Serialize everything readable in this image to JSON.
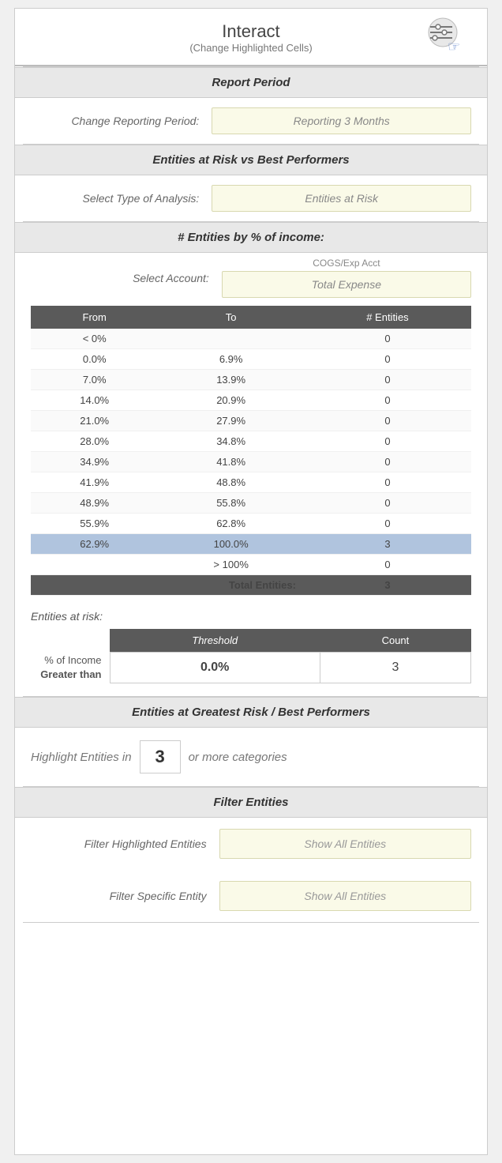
{
  "header": {
    "title": "Interact",
    "subtitle": "(Change Highlighted Cells)"
  },
  "report_period": {
    "label": "Report Period"
  },
  "change_reporting": {
    "label": "Change Reporting Period:",
    "dropdown": "Reporting 3 Months"
  },
  "entities_section": {
    "label": "Entities at Risk vs Best Performers"
  },
  "analysis": {
    "label": "Select Type of Analysis:",
    "dropdown": "Entities at Risk"
  },
  "entities_by_income": {
    "label": "# Entities by % of income:"
  },
  "account": {
    "label": "Select Account:",
    "sublabel": "COGS/Exp Acct",
    "dropdown": "Total Expense"
  },
  "table": {
    "headers": [
      "From",
      "To",
      "# Entities"
    ],
    "rows": [
      {
        "from": "< 0%",
        "to": "",
        "count": "0"
      },
      {
        "from": "0.0%",
        "to": "6.9%",
        "count": "0"
      },
      {
        "from": "7.0%",
        "to": "13.9%",
        "count": "0"
      },
      {
        "from": "14.0%",
        "to": "20.9%",
        "count": "0"
      },
      {
        "from": "21.0%",
        "to": "27.9%",
        "count": "0"
      },
      {
        "from": "28.0%",
        "to": "34.8%",
        "count": "0"
      },
      {
        "from": "34.9%",
        "to": "41.8%",
        "count": "0"
      },
      {
        "from": "41.9%",
        "to": "48.8%",
        "count": "0"
      },
      {
        "from": "48.9%",
        "to": "55.8%",
        "count": "0"
      },
      {
        "from": "55.9%",
        "to": "62.8%",
        "count": "0"
      },
      {
        "from": "62.9%",
        "to": "100.0%",
        "count": "3",
        "highlighted": true
      },
      {
        "from": "",
        "to": "> 100%",
        "count": "0"
      }
    ],
    "total_label": "Total Entities:",
    "total_value": "3"
  },
  "risk_label": "Entities at risk:",
  "threshold_table": {
    "col1": "Threshold",
    "col2": "Count",
    "row_label_line1": "% of Income",
    "row_label_line2": "Greater than",
    "threshold_val": "0.0%",
    "count_val": "3"
  },
  "greatest_risk": {
    "label": "Entities at Greatest Risk / Best Performers"
  },
  "highlight": {
    "prefix": "Highlight Entities in",
    "number": "3",
    "suffix": "or more categories"
  },
  "filter_entities": {
    "label": "Filter Entities"
  },
  "filter_highlighted": {
    "label": "Filter Highlighted Entities",
    "dropdown": "Show All Entities"
  },
  "filter_specific": {
    "label": "Filter Specific Entity",
    "dropdown": "Show All Entities"
  }
}
